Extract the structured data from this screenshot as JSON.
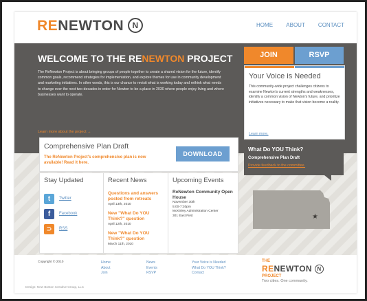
{
  "header": {
    "logo_re": "RE",
    "logo_rest": "NEWTON",
    "logo_n": "N",
    "nav": [
      "HOME",
      "ABOUT",
      "CONTACT"
    ]
  },
  "banner": {
    "title_pre": "WELCOME TO THE RE",
    "title_hl": "NEWTON",
    "title_post": " PROJECT",
    "body": "The ReNewton Project is about bringing groups of people together to create a shared vision for the future, identify common goals, recommend strategies for implementation, and explore themes for use in community development and marketing initiatives. In other words, this is our chance to revisit what is working today and rethink what needs to change over the next two decades in order for Newton to be a place in 2030 where people enjoy living and where businesses want to operate.",
    "more_link": "Learn more about the project →"
  },
  "buttons": {
    "join": "JOIN",
    "rsvp": "RSVP"
  },
  "voice": {
    "title": "Your Voice is Needed",
    "body": "This community-wide project challenges citizens to examine Newton's current strengths and weaknesses, identify a common vision of Newton's future, and prioritize initiatives necessary to make that vision become a reality.",
    "link": "Learn more."
  },
  "think": {
    "title": "What Do YOU Think?",
    "subtitle": "Comprehensive Plan Draft",
    "link": "Provide feedback to the committee."
  },
  "plan": {
    "title": "Comprehensive Plan Draft",
    "body": "The ReNewton Project's comprehensive plan is now available! Read it here.",
    "download": "DOWNLOAD"
  },
  "stay_updated": {
    "title": "Stay Updated",
    "links": [
      {
        "icon": "twitter-icon",
        "label": "Twitter",
        "color": "#5aa6d8"
      },
      {
        "icon": "facebook-icon",
        "label": "Facebook",
        "color": "#3b5c9c"
      },
      {
        "icon": "rss-icon",
        "label": "RSS",
        "color": "#f0882b"
      }
    ]
  },
  "recent_news": {
    "title": "Recent News",
    "items": [
      {
        "title": "Questions and answers posted from retreats",
        "date": "April 13th, 2010"
      },
      {
        "title": "New \"What Do YOU Think?\" question",
        "date": "April 12th, 2010"
      },
      {
        "title": "New \"What Do YOU Think?\" question",
        "date": "March 11th, 2010"
      }
    ]
  },
  "events": {
    "title": "Upcoming Events",
    "event_title": "ReNewton Community Open House",
    "lines": [
      "November 30th",
      "5:00-7:30pm",
      "McKinley Administration Center",
      "301 East First"
    ]
  },
  "footer": {
    "copyright": "Copyright © 2010",
    "col1": [
      "Home",
      "About",
      "Join"
    ],
    "col2": [
      "News",
      "Events",
      "RSVP"
    ],
    "col3": [
      "Your Voice is Needed",
      "What Do YOU Think?",
      "Contact"
    ],
    "logo_the": "THE",
    "logo_re": "RE",
    "logo_rest": "NEWTON",
    "logo_n": "N",
    "logo_project": "PROJECT",
    "tagline": "Two cities. One community.",
    "design_credit": "Design: New Boston Creative Group, LLC"
  },
  "colors": {
    "orange": "#f0882b",
    "blue": "#6c9fd0",
    "dark": "#5c5a58"
  }
}
